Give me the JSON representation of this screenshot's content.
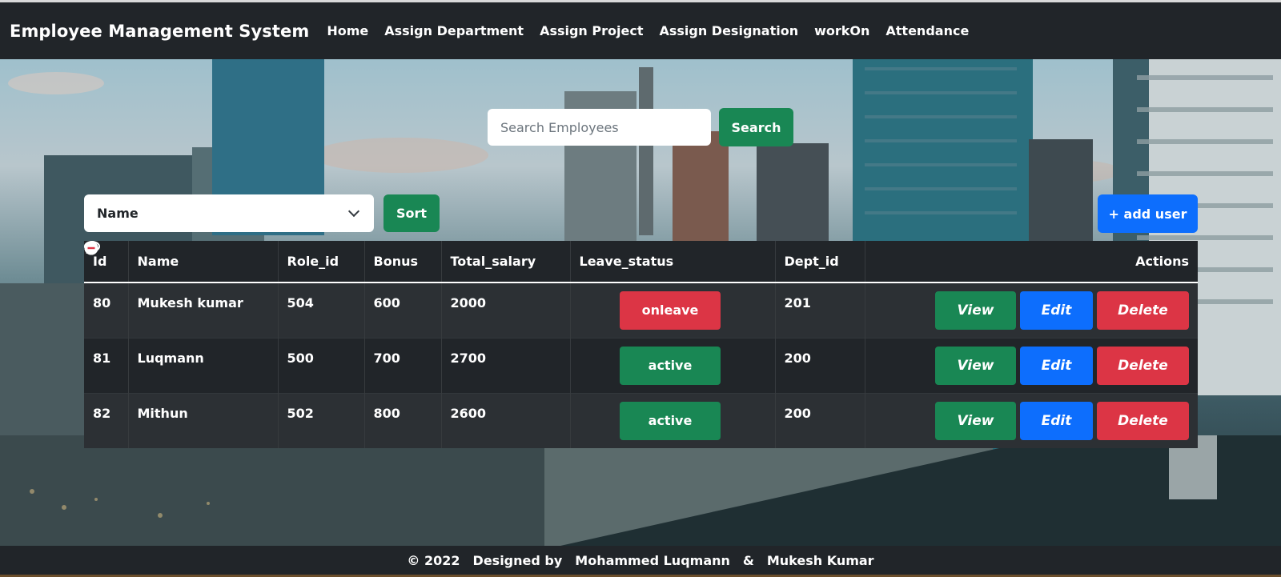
{
  "app": {
    "title": "Employee Management System"
  },
  "nav": {
    "items": [
      {
        "label": "Home"
      },
      {
        "label": "Assign Department"
      },
      {
        "label": "Assign Project"
      },
      {
        "label": "Assign Designation"
      },
      {
        "label": "workOn"
      },
      {
        "label": "Attendance"
      }
    ]
  },
  "search": {
    "placeholder": "Search Employees",
    "value": "",
    "button_label": "Search"
  },
  "sort": {
    "selected": "Name",
    "button_label": "Sort"
  },
  "add_user_label": "+ add user",
  "table": {
    "headers": [
      "Id",
      "Name",
      "Role_id",
      "Bonus",
      "Total_salary",
      "Leave_status",
      "Dept_id",
      "Actions"
    ],
    "rows": [
      {
        "id": "80",
        "name": "Mukesh kumar",
        "role_id": "504",
        "bonus": "600",
        "total_salary": "2000",
        "leave_status": "onleave",
        "dept_id": "201"
      },
      {
        "id": "81",
        "name": "Luqmann",
        "role_id": "500",
        "bonus": "700",
        "total_salary": "2700",
        "leave_status": "active",
        "dept_id": "200"
      },
      {
        "id": "82",
        "name": "Mithun",
        "role_id": "502",
        "bonus": "800",
        "total_salary": "2600",
        "leave_status": "active",
        "dept_id": "200"
      }
    ],
    "actions": {
      "view": "View",
      "edit": "Edit",
      "delete": "Delete"
    }
  },
  "footer": {
    "copyright": "© 2022",
    "designed_by": "Designed by",
    "author1": "Mohammed Luqmann",
    "amp": "&",
    "author2": "Mukesh Kumar"
  },
  "colors": {
    "navbar": "#212529",
    "success": "#198754",
    "primary": "#0d6efd",
    "danger": "#dc3545"
  },
  "icons": [
    "eye-icon",
    "pencil-icon",
    "minus-circle-icon",
    "chevron-down-icon"
  ]
}
